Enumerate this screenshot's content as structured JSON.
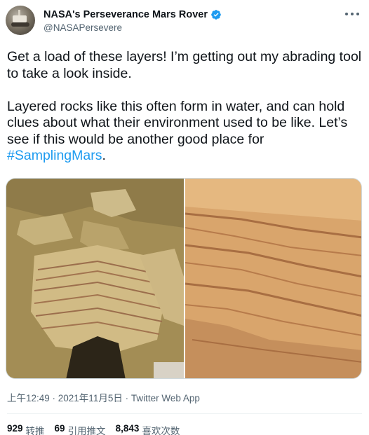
{
  "author": {
    "display_name": "NASA's Perseverance Mars Rover",
    "handle": "@NASAPersevere"
  },
  "tweet": {
    "paragraph_1": "Get a load of these layers! I’m getting out my abrading tool to take a look inside.",
    "paragraph_2_text": "Layered rocks like this often form in water, and can hold clues about what their environment used to be like. Let’s see if this would be another good place for ",
    "hashtag": "#SamplingMars",
    "paragraph_2_end": "."
  },
  "meta": {
    "timestamp": "上午12:49 · 2021年11月5日 · Twitter Web App"
  },
  "stats": [
    {
      "value": "929",
      "label": "转推"
    },
    {
      "value": "69",
      "label": "引用推文"
    },
    {
      "value": "8,843",
      "label": "喜欢次数"
    }
  ],
  "colors": {
    "link": "#1d9bf0",
    "verified": "#1d9bf0",
    "secondary_text": "#536471"
  },
  "icons": {
    "verified": "verified-badge-icon",
    "more": "more-options-icon"
  }
}
